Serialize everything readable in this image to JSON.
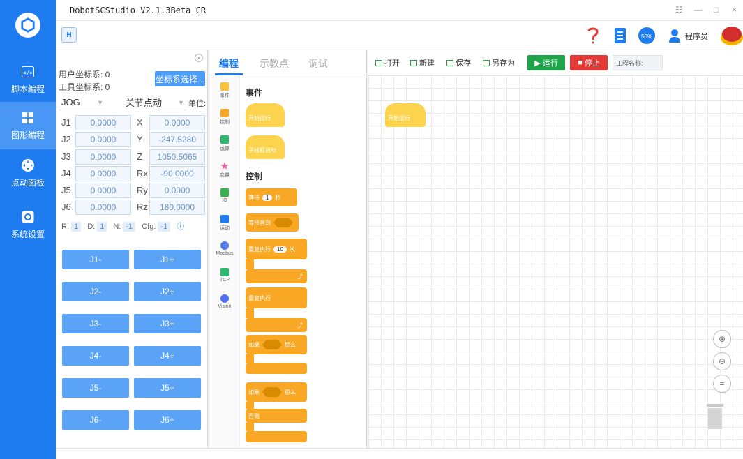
{
  "window": {
    "title": "DobotSCStudio V2.1.3Beta_CR",
    "controls": [
      "☷",
      "—",
      "□",
      "×"
    ]
  },
  "nav": {
    "items": [
      {
        "label": "脚本编程",
        "icon": "code-icon"
      },
      {
        "label": "图形编程",
        "icon": "puzzle-icon"
      },
      {
        "label": "点动面板",
        "icon": "dpad-icon"
      },
      {
        "label": "系统设置",
        "icon": "gear-icon"
      }
    ],
    "active_index": 1
  },
  "toolbar": {
    "left_button": "H",
    "user_label": "程序员",
    "speed_badge": "50%"
  },
  "left_panel": {
    "user_coord": "用户坐标系: 0",
    "tool_coord": "工具坐标系: 0",
    "coord_select_button": "坐标系选择...",
    "mode_select": "JOG",
    "jog_select": "关节点动",
    "unit_label": "单位:",
    "joints": [
      {
        "label": "J1",
        "value": "0.0000"
      },
      {
        "label": "J2",
        "value": "0.0000"
      },
      {
        "label": "J3",
        "value": "0.0000"
      },
      {
        "label": "J4",
        "value": "0.0000"
      },
      {
        "label": "J5",
        "value": "0.0000"
      },
      {
        "label": "J6",
        "value": "0.0000"
      }
    ],
    "cartesian": [
      {
        "label": "X",
        "value": "0.0000"
      },
      {
        "label": "Y",
        "value": "-247.5280"
      },
      {
        "label": "Z",
        "value": "1050.5065"
      },
      {
        "label": "Rx",
        "value": "-90.0000"
      },
      {
        "label": "Ry",
        "value": "0.0000"
      },
      {
        "label": "Rz",
        "value": "180.0000"
      }
    ],
    "config": {
      "r_label": "R:",
      "r": "1",
      "d_label": "D:",
      "d": "1",
      "n_label": "N:",
      "n": "-1",
      "cfg_label": "Cfg:",
      "cfg": "-1"
    },
    "jog_buttons": [
      "J1-",
      "J1+",
      "J2-",
      "J2+",
      "J3-",
      "J3+",
      "J4-",
      "J4+",
      "J5-",
      "J5+",
      "J6-",
      "J6+"
    ]
  },
  "blocks_panel": {
    "tabs": [
      "编程",
      "示教点",
      "调试"
    ],
    "categories": [
      {
        "label": "事件",
        "color": "#f9c23c"
      },
      {
        "label": "控制",
        "color": "#f9a825"
      },
      {
        "label": "运算",
        "color": "#2eb872"
      },
      {
        "label": "变量",
        "color": "#ef5da8"
      },
      {
        "label": "IO",
        "color": "#37b24d"
      },
      {
        "label": "运动",
        "color": "#1e7cf0"
      },
      {
        "label": "Modbus",
        "color": "#5a7bea"
      },
      {
        "label": "TCP",
        "color": "#2eb872"
      },
      {
        "label": "Vision",
        "color": "#4c6ef5"
      }
    ],
    "sections": {
      "events": "事件",
      "control": "控制"
    },
    "event_blocks": [
      "开始运行",
      "子线程启动"
    ],
    "control_blocks": {
      "wait": "等待",
      "wait_value": "1",
      "wait_unit": "秒",
      "wait_until": "等待直到",
      "repeat": "重复执行",
      "repeat_value": "10",
      "repeat_unit": "次",
      "forever": "重复执行",
      "if": "如果",
      "then": "那么",
      "if2": "如果",
      "then2": "那么",
      "else": "否则"
    }
  },
  "canvas": {
    "toolbar": {
      "open": "打开",
      "new": "新建",
      "save": "保存",
      "save_as": "另存为",
      "run": "运行",
      "stop": "停止",
      "project_name": "工程名称:"
    },
    "start_block": "开始运行",
    "zoom_buttons": [
      "⊕",
      "⊖",
      "="
    ]
  },
  "colors": {
    "nav": "#1e7cf0",
    "accent": "#1e7cf0",
    "block": "#f9a825",
    "run": "#1fa44a",
    "stop": "#e53935"
  }
}
